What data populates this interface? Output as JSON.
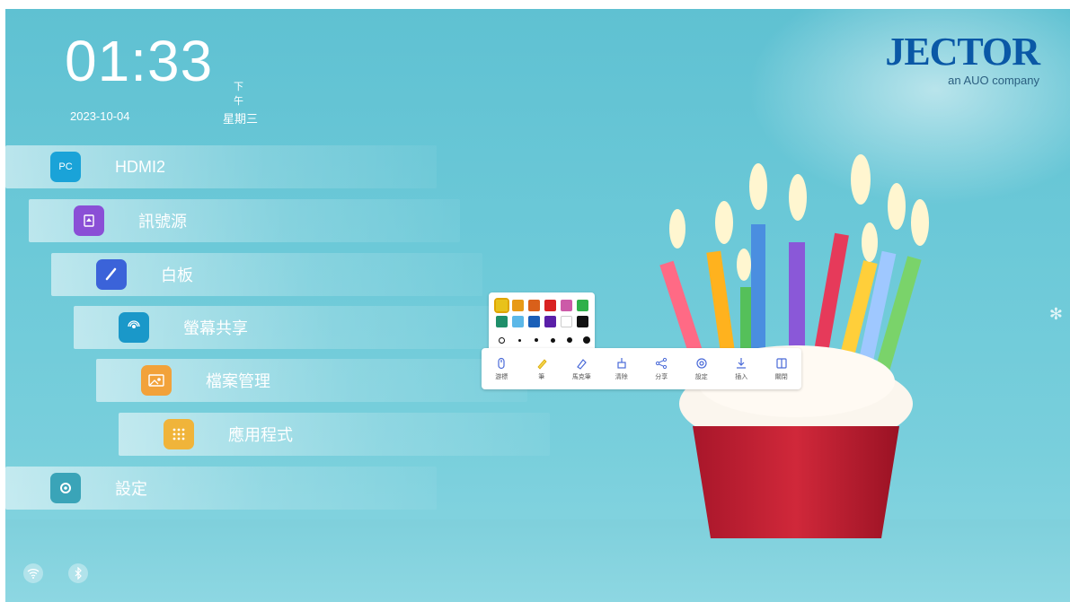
{
  "clock": {
    "time": "01:33",
    "ampm": "下午",
    "date": "2023-10-04",
    "weekday": "星期三"
  },
  "logo": {
    "brand": "JECTOR",
    "tagline": "an AUO company"
  },
  "menu": {
    "items": [
      {
        "label": "HDMI2",
        "icon": "pc-icon",
        "icon_text": "PC",
        "color": "#1aa3d8"
      },
      {
        "label": "訊號源",
        "icon": "signal-source-icon",
        "color": "#8a4fd6"
      },
      {
        "label": "白板",
        "icon": "whiteboard-icon",
        "color": "#3b63d9"
      },
      {
        "label": "螢幕共享",
        "icon": "screen-share-icon",
        "color": "#1a98c9"
      },
      {
        "label": "檔案管理",
        "icon": "folder-icon",
        "color": "#f2a23a"
      },
      {
        "label": "應用程式",
        "icon": "apps-grid-icon",
        "color": "#f0b43a"
      },
      {
        "label": "設定",
        "icon": "gear-icon",
        "color": "#3aa4b8"
      }
    ]
  },
  "palette": {
    "colors": [
      "#e8c21a",
      "#e89a18",
      "#d9601a",
      "#d92222",
      "#cc5aa8",
      "#2fb04a",
      "#1f8f6a",
      "#5cb8e8",
      "#1a5fb8",
      "#5a1fa8",
      "#ffffff",
      "#111111"
    ]
  },
  "toolbar": {
    "tools": [
      {
        "label": "游標",
        "icon": "mouse-icon"
      },
      {
        "label": "筆",
        "icon": "pen-icon"
      },
      {
        "label": "馬克筆",
        "icon": "marker-icon"
      },
      {
        "label": "清除",
        "icon": "eraser-icon"
      },
      {
        "label": "分享",
        "icon": "share-icon"
      },
      {
        "label": "設定",
        "icon": "settings-icon"
      },
      {
        "label": "插入",
        "icon": "insert-icon"
      },
      {
        "label": "關閉",
        "icon": "close-icon"
      }
    ]
  },
  "status": {
    "wifi": "wifi-icon",
    "bluetooth": "bluetooth-icon"
  }
}
